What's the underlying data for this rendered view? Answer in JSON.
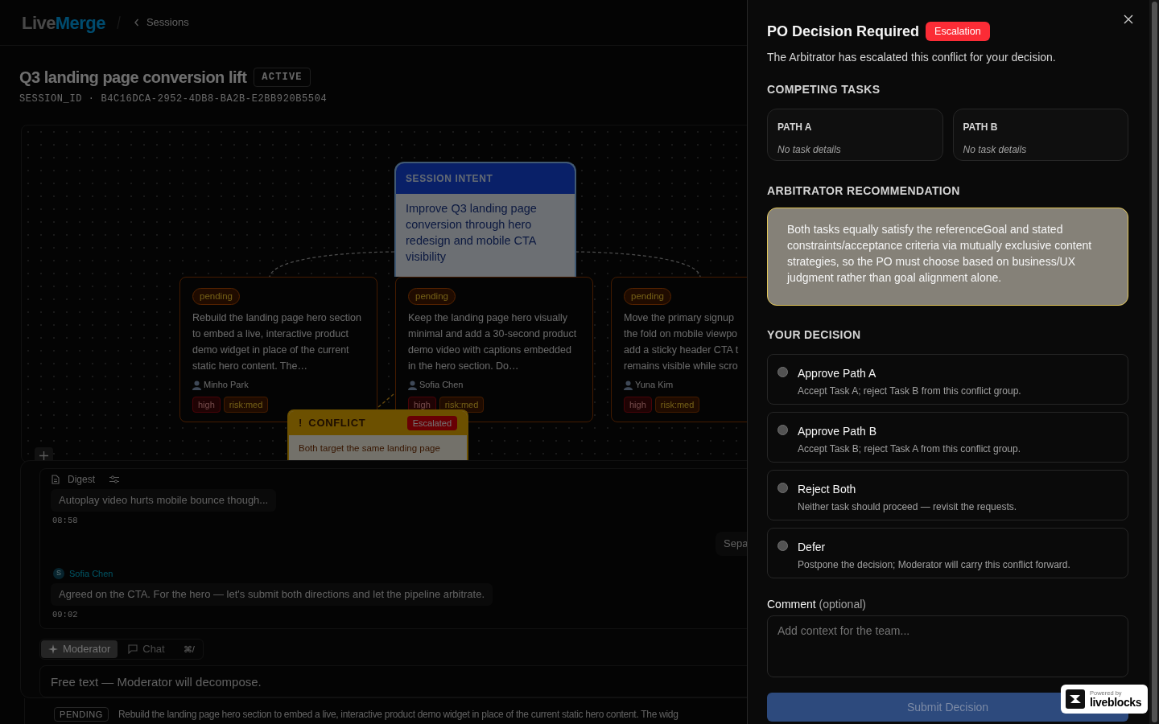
{
  "header": {
    "logo": {
      "text": "Live",
      "accent": "Merge"
    },
    "breadcrumb": "Sessions"
  },
  "session": {
    "title": "Q3 landing page conversion lift",
    "status": "ACTIVE",
    "id_line": "SESSION_ID · B4C16DCA-2952-4DB8-BA2B-E2BB920B5504"
  },
  "canvas": {
    "intent": {
      "header": "SESSION INTENT",
      "text": "Improve Q3 landing page conversion through hero redesign and mobile CTA visibility"
    },
    "tasks": [
      {
        "status": "pending",
        "text": "Rebuild the landing page hero section to embed a live, interactive product demo widget in place of the current static hero content. The…",
        "assignee": "Minho Park",
        "tags": [
          {
            "label": "high",
            "kind": "priority"
          },
          {
            "label": "risk:med",
            "kind": "risk"
          }
        ]
      },
      {
        "status": "pending",
        "text": "Keep the landing page hero visually minimal and add a 30-second product demo video with captions embedded in the hero section. Do…",
        "assignee": "Sofia Chen",
        "tags": [
          {
            "label": "high",
            "kind": "priority"
          },
          {
            "label": "risk:med",
            "kind": "risk"
          }
        ]
      },
      {
        "status": "pending",
        "lines": [
          "Move the primary signup",
          "the fold on mobile viewpo",
          "add a sticky header CTA t",
          "remains visible while scro"
        ],
        "assignee": "Yuna Kim",
        "tags": [
          {
            "label": "high",
            "kind": "priority"
          },
          {
            "label": "risk:med",
            "kind": "risk"
          }
        ]
      }
    ],
    "conflict": {
      "icon": "!",
      "label": "CONFLICT",
      "badge": "Escalated",
      "text": "Both target the same landing page"
    }
  },
  "chat": {
    "tab": "Digest",
    "messages": [
      {
        "kind": "incoming",
        "text": "Autoplay video hurts mobile bounce though...",
        "time": "08:58"
      },
      {
        "kind": "outgoing",
        "text": "Sepa"
      },
      {
        "kind": "authored",
        "avatar": "S",
        "author": "Sofia Chen",
        "text": "Agreed on the CTA. For the hero — let's submit both directions and let the pipeline arbitrate.",
        "time": "09:02"
      }
    ],
    "modes": [
      {
        "label": "Moderator",
        "selected": true
      },
      {
        "label": "Chat",
        "selected": false
      }
    ],
    "shortcut": "⌘/",
    "composer_placeholder": "Free text — Moderator will decompose."
  },
  "task_row": {
    "status": "PENDING",
    "text": "Rebuild the landing page hero section to embed a live, interactive product demo widget in place of the current static hero content. The widg"
  },
  "drawer": {
    "title": "PO Decision Required",
    "badge": "Escalation",
    "subtitle": "The Arbitrator has escalated this conflict for your decision.",
    "competing_heading": "COMPETING TASKS",
    "paths": [
      {
        "label": "PATH A",
        "detail": "No task details"
      },
      {
        "label": "PATH B",
        "detail": "No task details"
      }
    ],
    "recommendation_heading": "ARBITRATOR RECOMMENDATION",
    "recommendation": "Both tasks equally satisfy the referenceGoal and stated constraints/acceptance criteria via mutually exclusive content strategies, so the PO must choose based on business/UX judgment rather than goal alignment alone.",
    "decision_heading": "YOUR DECISION",
    "options": [
      {
        "title": "Approve Path A",
        "description": "Accept Task A; reject Task B from this conflict group.",
        "selected": false
      },
      {
        "title": "Approve Path B",
        "description": "Accept Task B; reject Task A from this conflict group.",
        "selected": false
      },
      {
        "title": "Reject Both",
        "description": "Neither task should proceed — revisit the requests.",
        "selected": false
      },
      {
        "title": "Defer",
        "description": "Postpone the decision; Moderator will carry this conflict forward.",
        "selected": false
      }
    ],
    "comment_label": "Comment",
    "comment_hint": "(optional)",
    "comment_placeholder": "Add context for the team...",
    "submit": {
      "label": "Submit Decision",
      "disabled": true
    }
  },
  "powered_badge": {
    "caption": "Powered by",
    "brand": "liveblocks"
  }
}
